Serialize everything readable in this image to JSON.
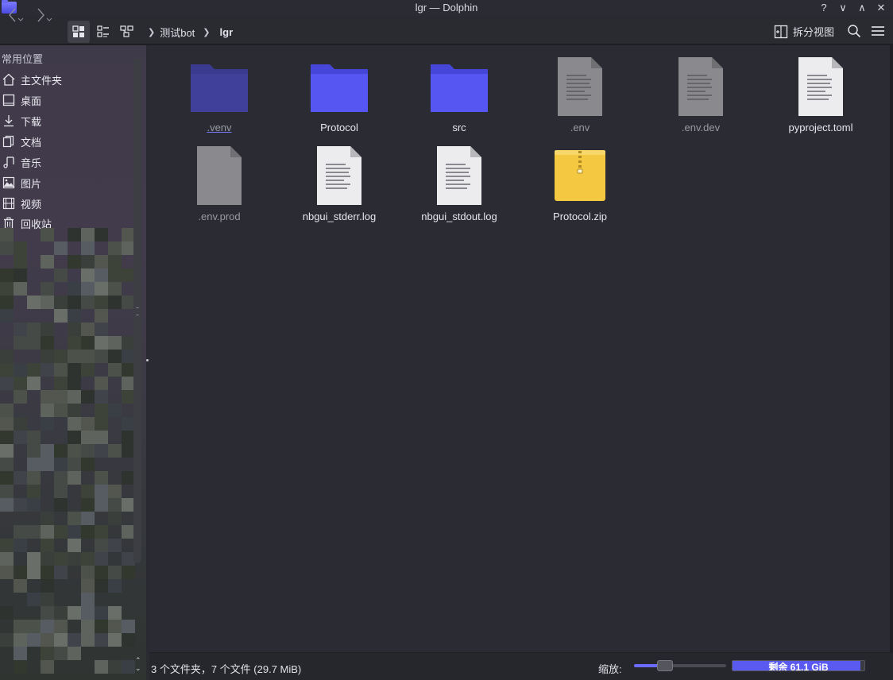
{
  "window": {
    "title": "lgr — Dolphin",
    "buttons": [
      "?",
      "∨",
      "∧",
      "✕"
    ]
  },
  "toolbar": {
    "back_icon": "chevron-left-icon",
    "forward_icon": "chevron-right-icon",
    "breadcrumb": [
      "测试bot",
      "lgr"
    ],
    "split_label": "拆分视图"
  },
  "sidebar": {
    "heading": "常用位置",
    "items": [
      {
        "label": "主文件夹",
        "icon": "home-icon"
      },
      {
        "label": "桌面",
        "icon": "desktop-icon"
      },
      {
        "label": "下载",
        "icon": "download-icon"
      },
      {
        "label": "文档",
        "icon": "documents-icon"
      },
      {
        "label": "音乐",
        "icon": "music-icon"
      },
      {
        "label": "图片",
        "icon": "pictures-icon"
      },
      {
        "label": "视频",
        "icon": "video-icon"
      },
      {
        "label": "回收站",
        "icon": "trash-icon"
      }
    ]
  },
  "files": [
    {
      "name": ".venv",
      "type": "folder-dark",
      "dim": true,
      "underline": true
    },
    {
      "name": "Protocol",
      "type": "folder",
      "dim": false
    },
    {
      "name": "src",
      "type": "folder",
      "dim": false
    },
    {
      "name": ".env",
      "type": "text-gray",
      "dim": true
    },
    {
      "name": ".env.dev",
      "type": "text-gray",
      "dim": true
    },
    {
      "name": "pyproject.toml",
      "type": "text",
      "dim": false
    },
    {
      "name": ".env.prod",
      "type": "blank-gray",
      "dim": true
    },
    {
      "name": "nbgui_stderr.log",
      "type": "text",
      "dim": false
    },
    {
      "name": "nbgui_stdout.log",
      "type": "text",
      "dim": false
    },
    {
      "name": "Protocol.zip",
      "type": "zip",
      "dim": false
    }
  ],
  "statusbar": {
    "summary": "3 个文件夹，7 个文件 (29.7 MiB)",
    "zoom_label": "缩放:",
    "zoom_level": 0.3,
    "free_space": "剩余 61.1 GiB",
    "used_fraction": 0.97
  },
  "colors": {
    "accent": "#5b5bff",
    "folder": "#5656f2",
    "folder_dark": "#40409a",
    "zip": "#f5c842"
  }
}
